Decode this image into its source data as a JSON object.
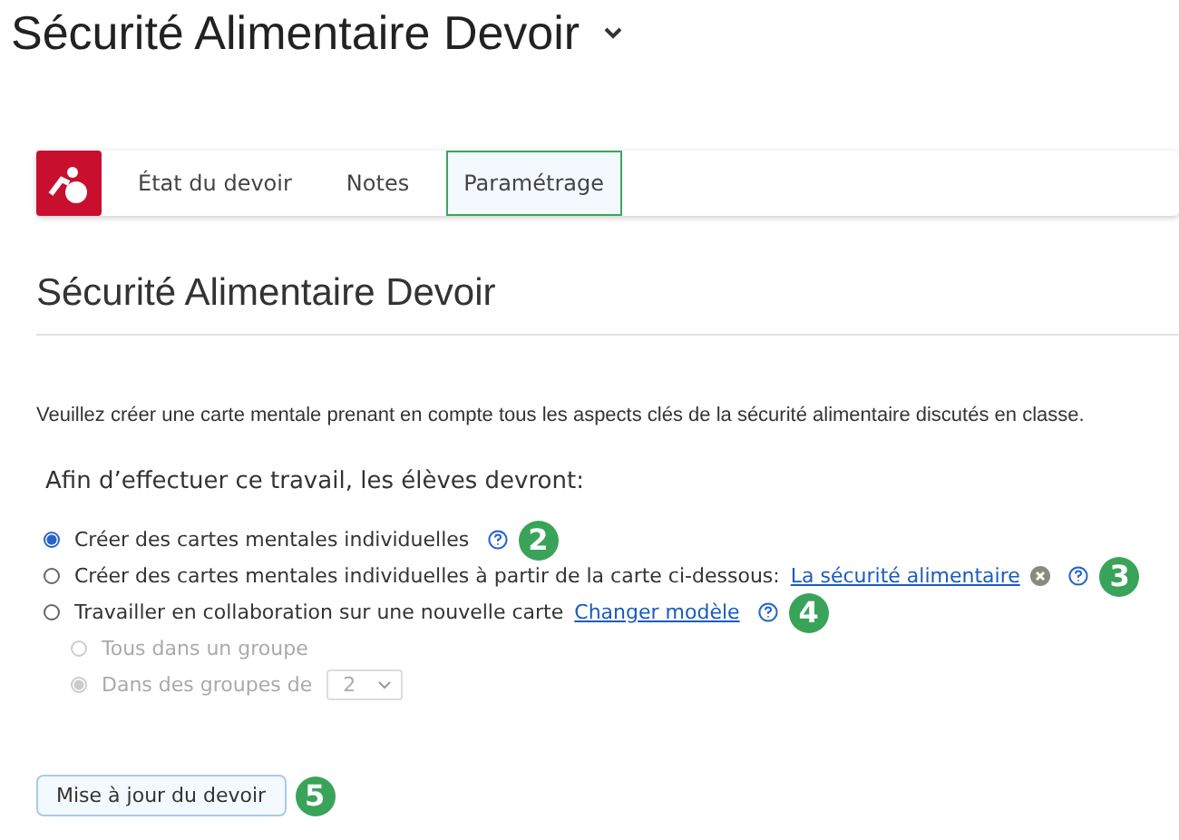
{
  "page_title": "Sécurité Alimentaire Devoir",
  "tabs": [
    {
      "label": "État du devoir",
      "selected": false
    },
    {
      "label": "Notes",
      "selected": false
    },
    {
      "label": "Paramétrage",
      "selected": true
    }
  ],
  "heading": "Sécurité Alimentaire Devoir",
  "description": "Veuillez créer une carte mentale prenant en compte tous les aspects clés de la sécurité alimentaire discutés en classe.",
  "subheading": "Afin d’effectuer ce travail, les élèves devront:",
  "options": [
    {
      "label": "Créer des cartes mentales individuelles",
      "selected": true,
      "badge": "2"
    },
    {
      "label": "Créer des cartes mentales individuelles à partir de la carte ci-dessous:",
      "link": "La sécurité alimentaire",
      "removable": true,
      "selected": false,
      "badge": "3"
    },
    {
      "label": "Travailler en collaboration sur une nouvelle carte",
      "link": "Changer modèle",
      "selected": false,
      "badge": "4"
    }
  ],
  "sub_options": [
    {
      "label": "Tous dans un groupe",
      "selected": false,
      "disabled": true
    },
    {
      "label": "Dans des groupes de",
      "selected": true,
      "disabled": true,
      "select_value": "2"
    }
  ],
  "update_button": {
    "label": "Mise à jour du devoir",
    "badge": "5"
  }
}
